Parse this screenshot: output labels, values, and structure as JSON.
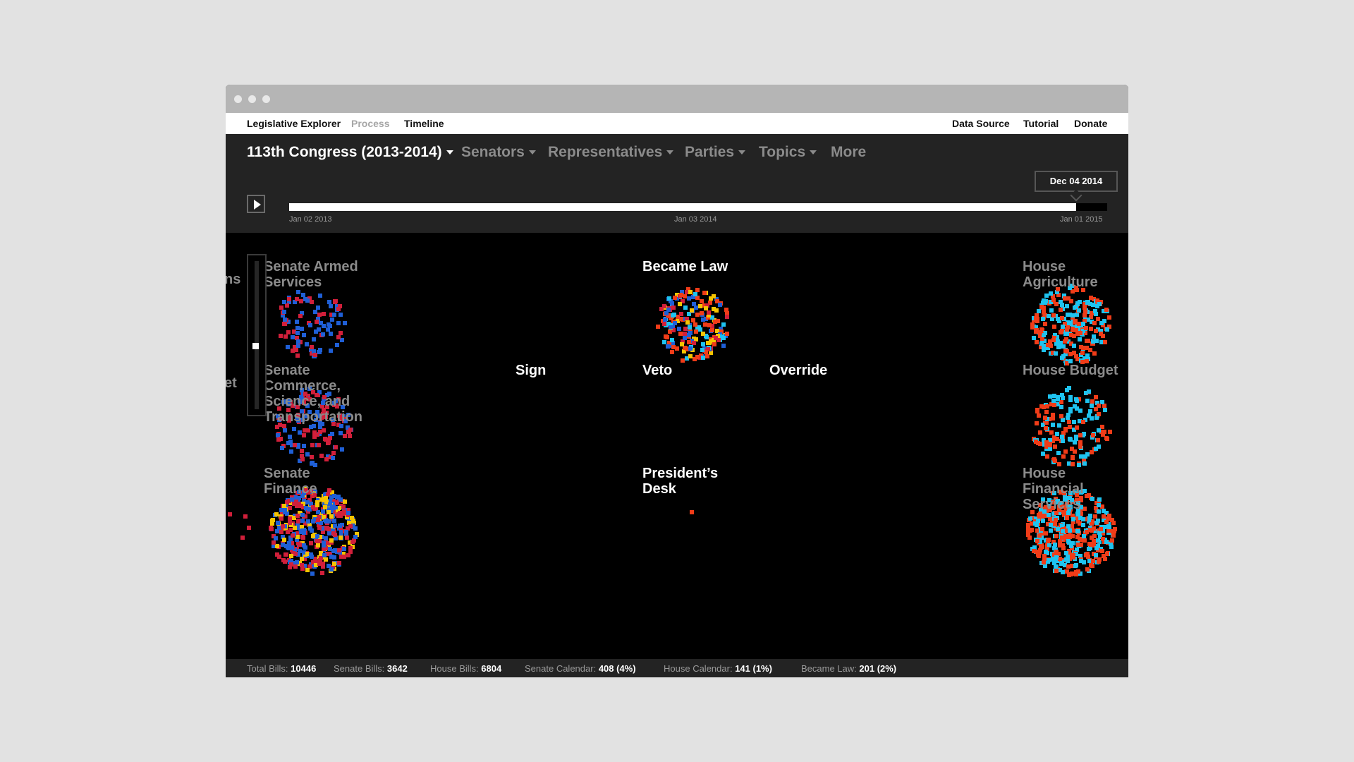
{
  "topnav": {
    "items": [
      "Legislative Explorer",
      "Process",
      "Timeline"
    ],
    "right": [
      "Data Source",
      "Tutorial",
      "Donate"
    ]
  },
  "filters": {
    "congress": "113th Congress (2013-2014)",
    "senators": "Senators",
    "representatives": "Representatives",
    "parties": "Parties",
    "topics": "Topics",
    "more": "More"
  },
  "timeline": {
    "start": "Jan 02 2013",
    "mid": "Jan 03 2014",
    "end": "Jan 01 2015",
    "current": "Dec 04 2014",
    "progress": 0.962
  },
  "stages": {
    "left_cut_1": "ns",
    "left_cut_2": "et",
    "senate_armed": "Senate Armed Services",
    "senate_commerce": "Senate Commerce, Science, and Transportation",
    "senate_finance": "Senate Finance",
    "became_law": "Became Law",
    "sign": "Sign",
    "veto": "Veto",
    "override": "Override",
    "presidents_desk": "President’s Desk",
    "house_agriculture": "House Agriculture",
    "house_budget": "House Budget",
    "house_financial": "House Financial Services"
  },
  "stats": {
    "total_label": "Total Bills:",
    "total": "10446",
    "senate_label": "Senate Bills:",
    "senate": "3642",
    "house_label": "House Bills:",
    "house": "6804",
    "senate_cal_label": "Senate Calendar:",
    "senate_cal": "408 (4%)",
    "house_cal_label": "House Calendar:",
    "house_cal": "141 (1%)",
    "law_label": "Became Law:",
    "law": "201 (2%)"
  },
  "colors": {
    "senate_dem": "#1f5fd6",
    "senate_rep": "#d11f3a",
    "house_dem": "#1ec3f0",
    "house_rep": "#f03c18",
    "independent": "#f5c400"
  }
}
